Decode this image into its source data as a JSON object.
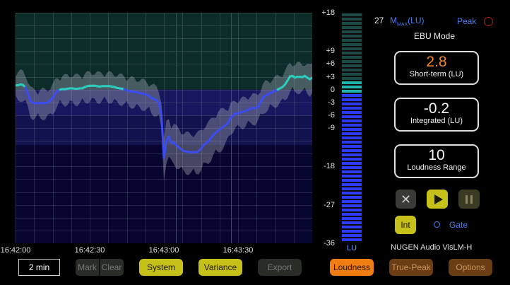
{
  "graph": {
    "y_ticks": [
      {
        "label": "+18",
        "value": 18
      },
      {
        "label": "+9",
        "value": 9
      },
      {
        "label": "+6",
        "value": 6
      },
      {
        "label": "+3",
        "value": 3
      },
      {
        "label": "0",
        "value": 0
      },
      {
        "label": "-3",
        "value": -3
      },
      {
        "label": "-6",
        "value": -6
      },
      {
        "label": "-9",
        "value": -9
      },
      {
        "label": "-18",
        "value": -18
      },
      {
        "label": "-27",
        "value": -27
      },
      {
        "label": "-36",
        "value": -36
      }
    ],
    "y_range": [
      -36,
      18
    ],
    "time_labels": [
      "16:42:00",
      "16:42:30",
      "16:43:00",
      "16:43:30"
    ],
    "time_label_seconds": [
      0,
      30,
      60,
      90
    ],
    "time_span_seconds": 120,
    "markers_seconds": [
      65,
      87
    ],
    "short_term_lu": [
      1.0,
      1.0,
      1.2,
      1.1,
      0.5,
      -1.0,
      -2.6,
      -3.1,
      -3.2,
      -3.2,
      -3.1,
      -3.1,
      -3.2,
      -3.0,
      -2.6,
      -2.0,
      -1.0,
      -0.3,
      0.0,
      0.1,
      0.1,
      0.2,
      0.3,
      0.3,
      0.2,
      0.2,
      0.3,
      0.3,
      0.6,
      0.8,
      0.9,
      0.9,
      0.9,
      0.8,
      0.7,
      0.8,
      0.8,
      0.8,
      0.8,
      0.7,
      0.6,
      0.4,
      0.3,
      0.2,
      0.1,
      -0.2,
      -0.4,
      -0.4,
      -0.5,
      -0.6,
      -0.8,
      -0.9,
      -1.0,
      -1.2,
      -1.5,
      -2.0,
      -2.2,
      -2.5,
      -3.1,
      -6.0,
      -16.0,
      -12.0,
      -11.0,
      -12.5,
      -12.4,
      -13.0,
      -13.5,
      -14.0,
      -14.4,
      -14.5,
      -14.6,
      -14.7,
      -14.6,
      -14.7,
      -14.4,
      -13.9,
      -13.0,
      -12.6,
      -12.1,
      -11.4,
      -10.6,
      -10.1,
      -9.6,
      -9.2,
      -8.7,
      -8.3,
      -7.8,
      -6.6,
      -6.1,
      -5.6,
      -5.6,
      -5.3,
      -5.2,
      -5.0,
      -4.7,
      -4.5,
      -4.3,
      -4.4,
      -4.1,
      -3.0,
      -2.0,
      -1.4,
      -1.2,
      -0.8,
      -0.6,
      -0.3,
      0.0,
      0.3,
      0.6,
      1.2,
      2.1,
      3.1,
      3.2,
      2.8,
      3.0,
      3.0,
      2.9,
      3.2,
      2.8,
      2.4,
      2.8
    ],
    "region_colors": {
      "above": "#0b2c28",
      "target": "#17175f",
      "middle": "#12124e",
      "below": "#060630"
    },
    "band_color": "#9aa0ae",
    "line_color_low": "#3b4cf0",
    "line_color_high": "#2ccfbf"
  },
  "meter": {
    "value_lu": 2.8,
    "unit": "LU",
    "colors": {
      "off": "#1e4a45",
      "teal": "#1fb5ad",
      "blue": "#2f3bff"
    }
  },
  "toolbar": {
    "time_range": "2 min",
    "mark": "Mark",
    "clear": "Clear",
    "system": "System",
    "variance": "Variance",
    "export": "Export"
  },
  "right": {
    "mmax_value": "27",
    "mmax_label_prefix": "M",
    "mmax_label_sub": "MAX",
    "mmax_label_suffix": "(LU)",
    "peak_label": "Peak",
    "mode": "EBU Mode",
    "short_term": {
      "value": "2.8",
      "label": "Short-term (LU)"
    },
    "integrated": {
      "value": "-0.2",
      "label": "Integrated (LU)"
    },
    "range": {
      "value": "10",
      "label": "Loudness Range"
    },
    "int_label": "Int",
    "gate_label": "Gate",
    "product": "NUGEN Audio VisLM-H",
    "tabs": {
      "loudness": "Loudness",
      "truepeak": "True-Peak",
      "options": "Options"
    }
  }
}
